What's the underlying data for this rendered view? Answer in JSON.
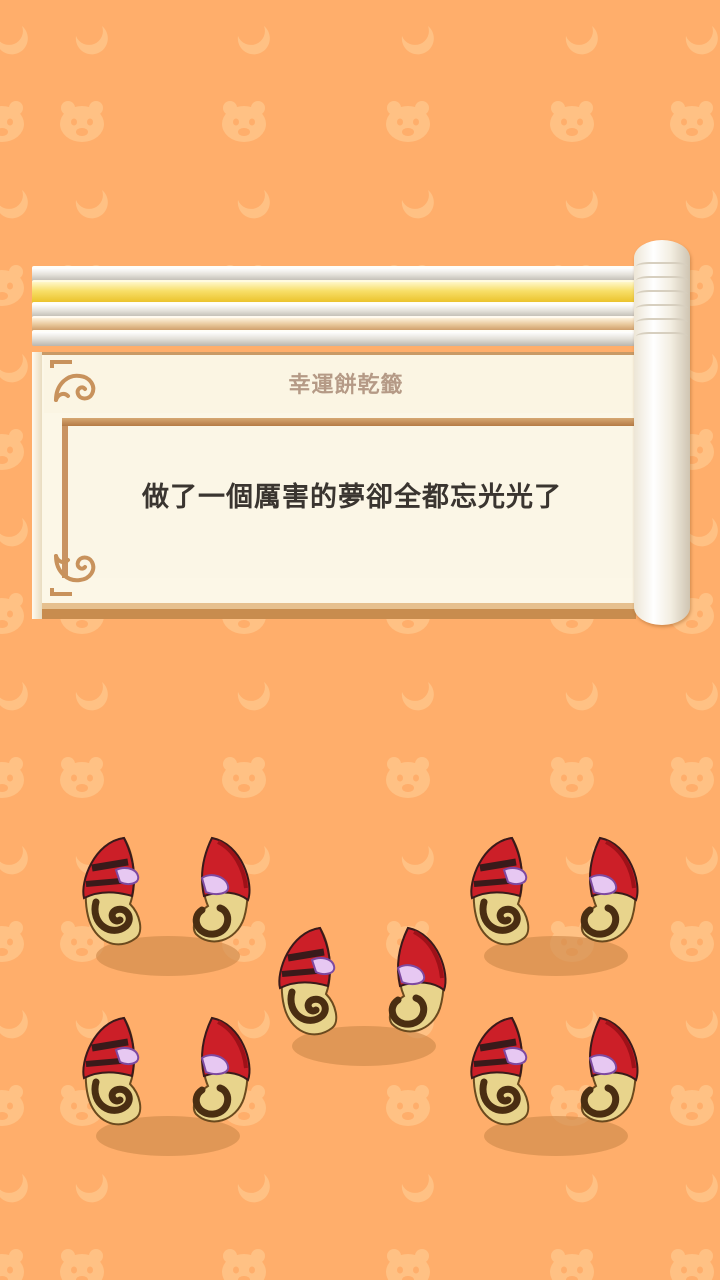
{
  "fortune_slip": {
    "title": "幸運餅乾籤",
    "message": "做了一個厲害的夢卻全都忘光光了"
  },
  "broken_cookies": {
    "count": 5
  },
  "colors": {
    "background": "#ffae6b",
    "pattern": "#ffc184",
    "scroll_trim": "#c8925c",
    "text": "#3a3530",
    "title_text": "#b59a86",
    "cookie_red": "#cc1f28",
    "cookie_dark": "#3a1a1a",
    "cookie_cream": "#e8d48c",
    "cookie_glaze": "#e7c8f2"
  },
  "icons": [
    "moon-pattern-icon",
    "bear-face-pattern-icon",
    "cloud-ornament-icon",
    "broken-cookie-icon"
  ]
}
